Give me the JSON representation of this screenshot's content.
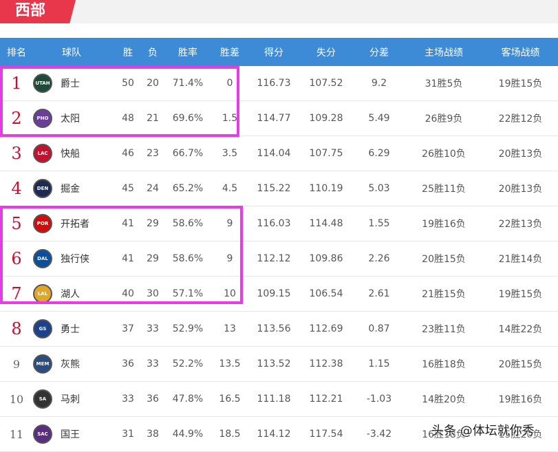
{
  "header": {
    "conference": "西部"
  },
  "columns": {
    "rank": "排名",
    "team": "球队",
    "w": "胜",
    "l": "负",
    "pct": "胜率",
    "gb": "胜差",
    "pf": "得分",
    "pa": "失分",
    "diff": "分差",
    "home": "主场战绩",
    "away": "客场战绩"
  },
  "rows": [
    {
      "rank": "1",
      "abbr": "UTAH",
      "name": "爵士",
      "w": "50",
      "l": "20",
      "pct": "71.4%",
      "gb": "0",
      "pf": "116.73",
      "pa": "107.52",
      "diff": "9.2",
      "home": "31胜5负",
      "away": "19胜15负",
      "color": "#1e4a3a"
    },
    {
      "rank": "2",
      "abbr": "PHO",
      "name": "太阳",
      "w": "48",
      "l": "21",
      "pct": "69.6%",
      "gb": "1.5",
      "pf": "114.77",
      "pa": "109.28",
      "diff": "5.49",
      "home": "26胜9负",
      "away": "22胜12负",
      "color": "#6a3f9a"
    },
    {
      "rank": "3",
      "abbr": "LAC",
      "name": "快船",
      "w": "46",
      "l": "23",
      "pct": "66.7%",
      "gb": "3.5",
      "pf": "114.04",
      "pa": "107.75",
      "diff": "6.29",
      "home": "26胜10负",
      "away": "20胜13负",
      "color": "#c8102e"
    },
    {
      "rank": "4",
      "abbr": "DEN",
      "name": "掘金",
      "w": "45",
      "l": "24",
      "pct": "65.2%",
      "gb": "4.5",
      "pf": "115.22",
      "pa": "110.19",
      "diff": "5.03",
      "home": "25胜11负",
      "away": "20胜13负",
      "color": "#1d2b50"
    },
    {
      "rank": "5",
      "abbr": "POR",
      "name": "开拓者",
      "w": "41",
      "l": "29",
      "pct": "58.6%",
      "gb": "9",
      "pf": "116.03",
      "pa": "114.48",
      "diff": "1.55",
      "home": "19胜16负",
      "away": "22胜13负",
      "color": "#d50a0a"
    },
    {
      "rank": "6",
      "abbr": "DAL",
      "name": "独行侠",
      "w": "41",
      "l": "29",
      "pct": "58.6%",
      "gb": "9",
      "pf": "112.12",
      "pa": "109.86",
      "diff": "2.26",
      "home": "20胜15负",
      "away": "21胜14负",
      "color": "#0b4f9c"
    },
    {
      "rank": "7",
      "abbr": "LAL",
      "name": "湖人",
      "w": "40",
      "l": "30",
      "pct": "57.1%",
      "gb": "10",
      "pf": "109.15",
      "pa": "106.54",
      "diff": "2.61",
      "home": "21胜15负",
      "away": "19胜15负",
      "color": "#e0a62a"
    },
    {
      "rank": "8",
      "abbr": "GS",
      "name": "勇士",
      "w": "37",
      "l": "33",
      "pct": "52.9%",
      "gb": "13",
      "pf": "113.56",
      "pa": "112.69",
      "diff": "0.87",
      "home": "23胜11负",
      "away": "14胜22负",
      "color": "#1d428a"
    },
    {
      "rank": "9",
      "abbr": "MEM",
      "name": "灰熊",
      "w": "36",
      "l": "33",
      "pct": "52.2%",
      "gb": "13.5",
      "pf": "113.52",
      "pa": "112.38",
      "diff": "1.15",
      "home": "16胜18负",
      "away": "20胜15负",
      "color": "#2b4c7e"
    },
    {
      "rank": "10",
      "abbr": "SA",
      "name": "马刺",
      "w": "33",
      "l": "36",
      "pct": "47.8%",
      "gb": "16.5",
      "pf": "111.18",
      "pa": "112.21",
      "diff": "-1.03",
      "home": "14胜20负",
      "away": "19胜16负",
      "color": "#333333"
    },
    {
      "rank": "11",
      "abbr": "SAC",
      "name": "国王",
      "w": "31",
      "l": "38",
      "pct": "44.9%",
      "gb": "18.5",
      "pf": "114.12",
      "pa": "117.54",
      "diff": "-3.42",
      "home": "16胜18负",
      "away": "15胜20负",
      "color": "#5a2d81"
    }
  ],
  "watermark": "头条 @体坛就你秀",
  "colors": {
    "header_bg": "#3d8bd6",
    "conference_tab": "#e8374b",
    "highlight": "#e83ae6",
    "rank_top": "#c8102e"
  }
}
